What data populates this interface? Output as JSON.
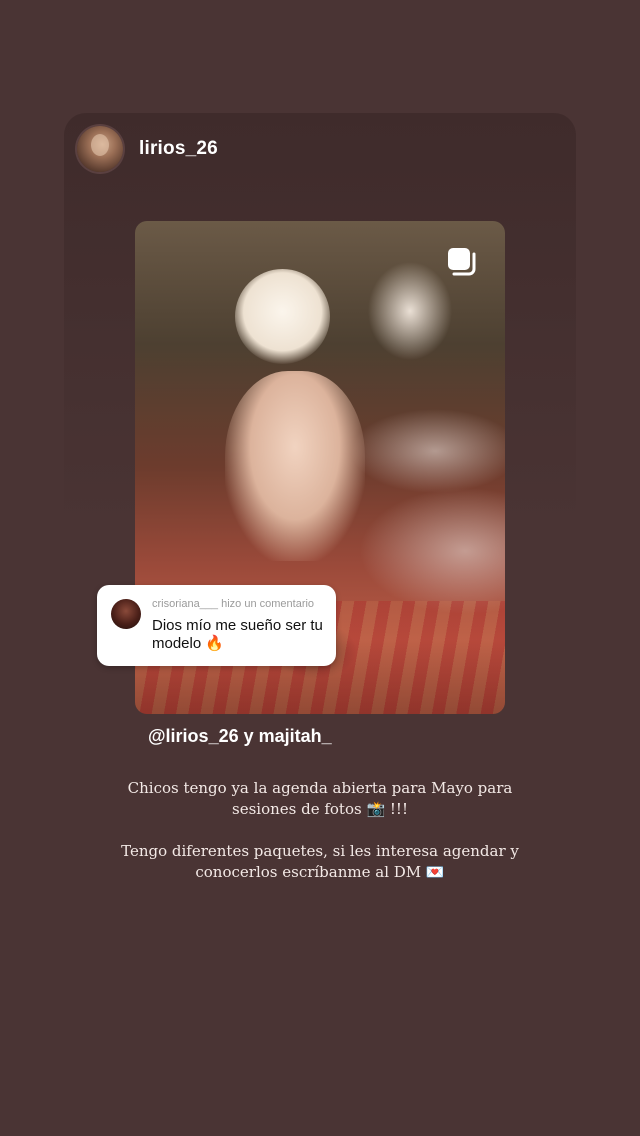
{
  "post": {
    "username": "lirios_26",
    "mention": "@lirios_26 y majitah_"
  },
  "comment": {
    "author": "crisoriana___",
    "action": "hizo un comentario",
    "text": "Dios mío me sueño ser tu modelo 🔥"
  },
  "caption": {
    "paragraph1": "Chicos tengo ya la agenda abierta para Mayo para sesiones de fotos 📸 !!!",
    "paragraph2": "Tengo diferentes paquetes, si les interesa agendar y conocerlos escríbanme al DM 💌"
  },
  "icons": {
    "multi_post": "carousel-icon"
  },
  "colors": {
    "background": "#4a3434",
    "sticker": "#ffffff"
  }
}
